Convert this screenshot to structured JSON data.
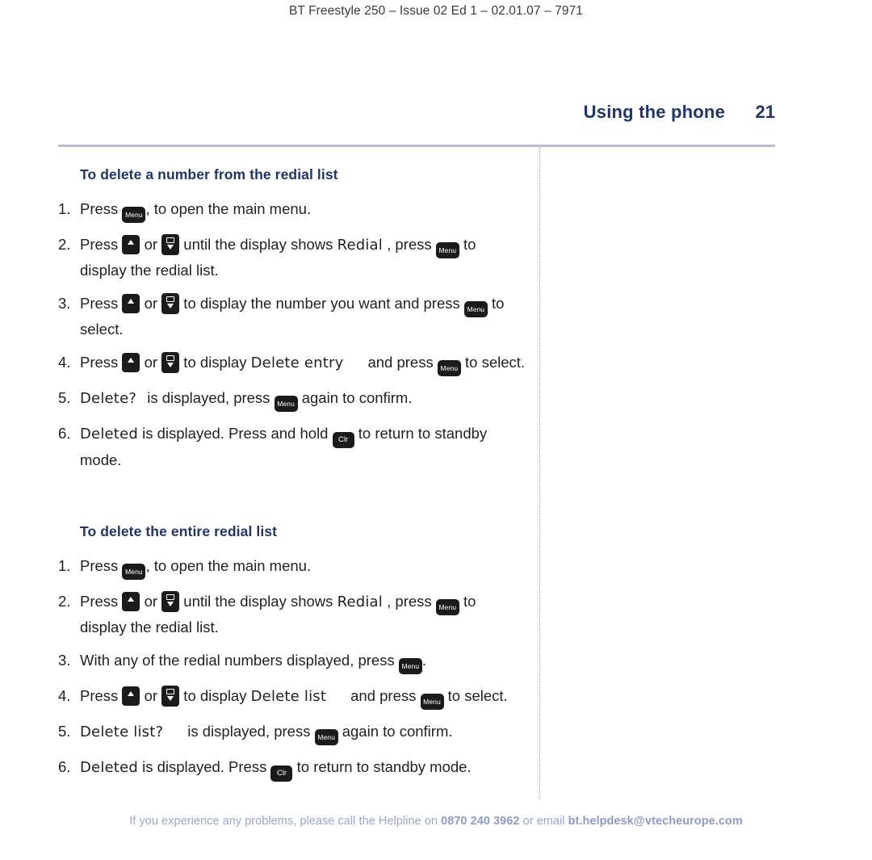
{
  "document": {
    "running_header": "BT Freestyle 250 – Issue 02 Ed 1 – 02.01.07 – 7971",
    "section_title": "Using the phone",
    "page_number": "21"
  },
  "keys": {
    "menu_label": "Menu",
    "clr_label": "Clr"
  },
  "sections": [
    {
      "heading": "To delete a number from the redial list",
      "steps": [
        {
          "num": "1.",
          "parts": [
            {
              "t": "text",
              "v": "Press "
            },
            {
              "t": "key",
              "v": "menu"
            },
            {
              "t": "text",
              "v": ", to open the main menu."
            }
          ]
        },
        {
          "num": "2.",
          "parts": [
            {
              "t": "text",
              "v": "Press "
            },
            {
              "t": "key",
              "v": "up"
            },
            {
              "t": "text",
              "v": " or "
            },
            {
              "t": "key",
              "v": "down"
            },
            {
              "t": "text",
              "v": " until the display shows "
            },
            {
              "t": "lcd",
              "v": "Redial"
            },
            {
              "t": "text",
              "v": " , press "
            },
            {
              "t": "key",
              "v": "menu"
            },
            {
              "t": "text",
              "v": " to display the redial list."
            }
          ]
        },
        {
          "num": "3.",
          "parts": [
            {
              "t": "text",
              "v": "Press "
            },
            {
              "t": "key",
              "v": "up"
            },
            {
              "t": "text",
              "v": " or "
            },
            {
              "t": "key",
              "v": "down"
            },
            {
              "t": "text",
              "v": " to display the number you want and press "
            },
            {
              "t": "key",
              "v": "menu"
            },
            {
              "t": "text",
              "v": " to select."
            }
          ]
        },
        {
          "num": "4.",
          "parts": [
            {
              "t": "text",
              "v": "Press "
            },
            {
              "t": "key",
              "v": "up"
            },
            {
              "t": "text",
              "v": " or "
            },
            {
              "t": "key",
              "v": "down"
            },
            {
              "t": "text",
              "v": " to display "
            },
            {
              "t": "lcd",
              "v": "Delete entry"
            },
            {
              "t": "pad",
              "v": ""
            },
            {
              "t": "text",
              "v": "and press "
            },
            {
              "t": "key",
              "v": "menu"
            },
            {
              "t": "text",
              "v": " to select."
            }
          ]
        },
        {
          "num": "5.",
          "parts": [
            {
              "t": "lcd",
              "v": "Delete?"
            },
            {
              "t": "pad-sm",
              "v": ""
            },
            {
              "t": "text",
              "v": " is displayed, press "
            },
            {
              "t": "key",
              "v": "menu"
            },
            {
              "t": "text",
              "v": " again to confirm."
            }
          ]
        },
        {
          "num": "6.",
          "parts": [
            {
              "t": "lcd",
              "v": "Deleted"
            },
            {
              "t": "text",
              "v": " is displayed. Press and hold "
            },
            {
              "t": "key",
              "v": "clr"
            },
            {
              "t": "text",
              "v": " to return to standby mode."
            }
          ]
        }
      ]
    },
    {
      "heading": "To delete the entire redial list",
      "steps": [
        {
          "num": "1.",
          "parts": [
            {
              "t": "text",
              "v": "Press "
            },
            {
              "t": "key",
              "v": "menu"
            },
            {
              "t": "text",
              "v": ", to open the main menu."
            }
          ]
        },
        {
          "num": "2.",
          "parts": [
            {
              "t": "text",
              "v": "Press "
            },
            {
              "t": "key",
              "v": "up"
            },
            {
              "t": "text",
              "v": " or "
            },
            {
              "t": "key",
              "v": "down"
            },
            {
              "t": "text",
              "v": " until the display shows "
            },
            {
              "t": "lcd",
              "v": "Redial"
            },
            {
              "t": "text",
              "v": " , press "
            },
            {
              "t": "key",
              "v": "menu"
            },
            {
              "t": "text",
              "v": " to display the redial list."
            }
          ]
        },
        {
          "num": "3.",
          "parts": [
            {
              "t": "text",
              "v": "With any of the redial numbers displayed, press "
            },
            {
              "t": "key",
              "v": "menu"
            },
            {
              "t": "text",
              "v": "."
            }
          ]
        },
        {
          "num": "4.",
          "parts": [
            {
              "t": "text",
              "v": "Press "
            },
            {
              "t": "key",
              "v": "up"
            },
            {
              "t": "text",
              "v": " or "
            },
            {
              "t": "key",
              "v": "down"
            },
            {
              "t": "text",
              "v": " to display "
            },
            {
              "t": "lcd",
              "v": "Delete list"
            },
            {
              "t": "pad",
              "v": ""
            },
            {
              "t": "text",
              "v": "and press "
            },
            {
              "t": "key",
              "v": "menu"
            },
            {
              "t": "text",
              "v": " to select."
            }
          ]
        },
        {
          "num": "5.",
          "parts": [
            {
              "t": "lcd",
              "v": "Delete list?"
            },
            {
              "t": "pad",
              "v": ""
            },
            {
              "t": "text",
              "v": "is displayed, press "
            },
            {
              "t": "key",
              "v": "menu"
            },
            {
              "t": "text",
              "v": " again to confirm."
            }
          ]
        },
        {
          "num": "6.",
          "parts": [
            {
              "t": "lcd",
              "v": "Deleted"
            },
            {
              "t": "text",
              "v": " is displayed. Press "
            },
            {
              "t": "key",
              "v": "clr"
            },
            {
              "t": "text",
              "v": " to return to standby mode."
            }
          ]
        }
      ]
    }
  ],
  "footer": {
    "lead": "If you experience any problems, please call the Helpline on ",
    "phone": "0870 240 3962",
    "mid": " or email ",
    "email": "bt.helpdesk@vtecheurope.com"
  },
  "colors": {
    "heading_blue": "#1f3570",
    "rule_blue": "#b7b9dd",
    "footer_blue": "#9aa4cf",
    "key_dark": "#1c1a1b"
  }
}
